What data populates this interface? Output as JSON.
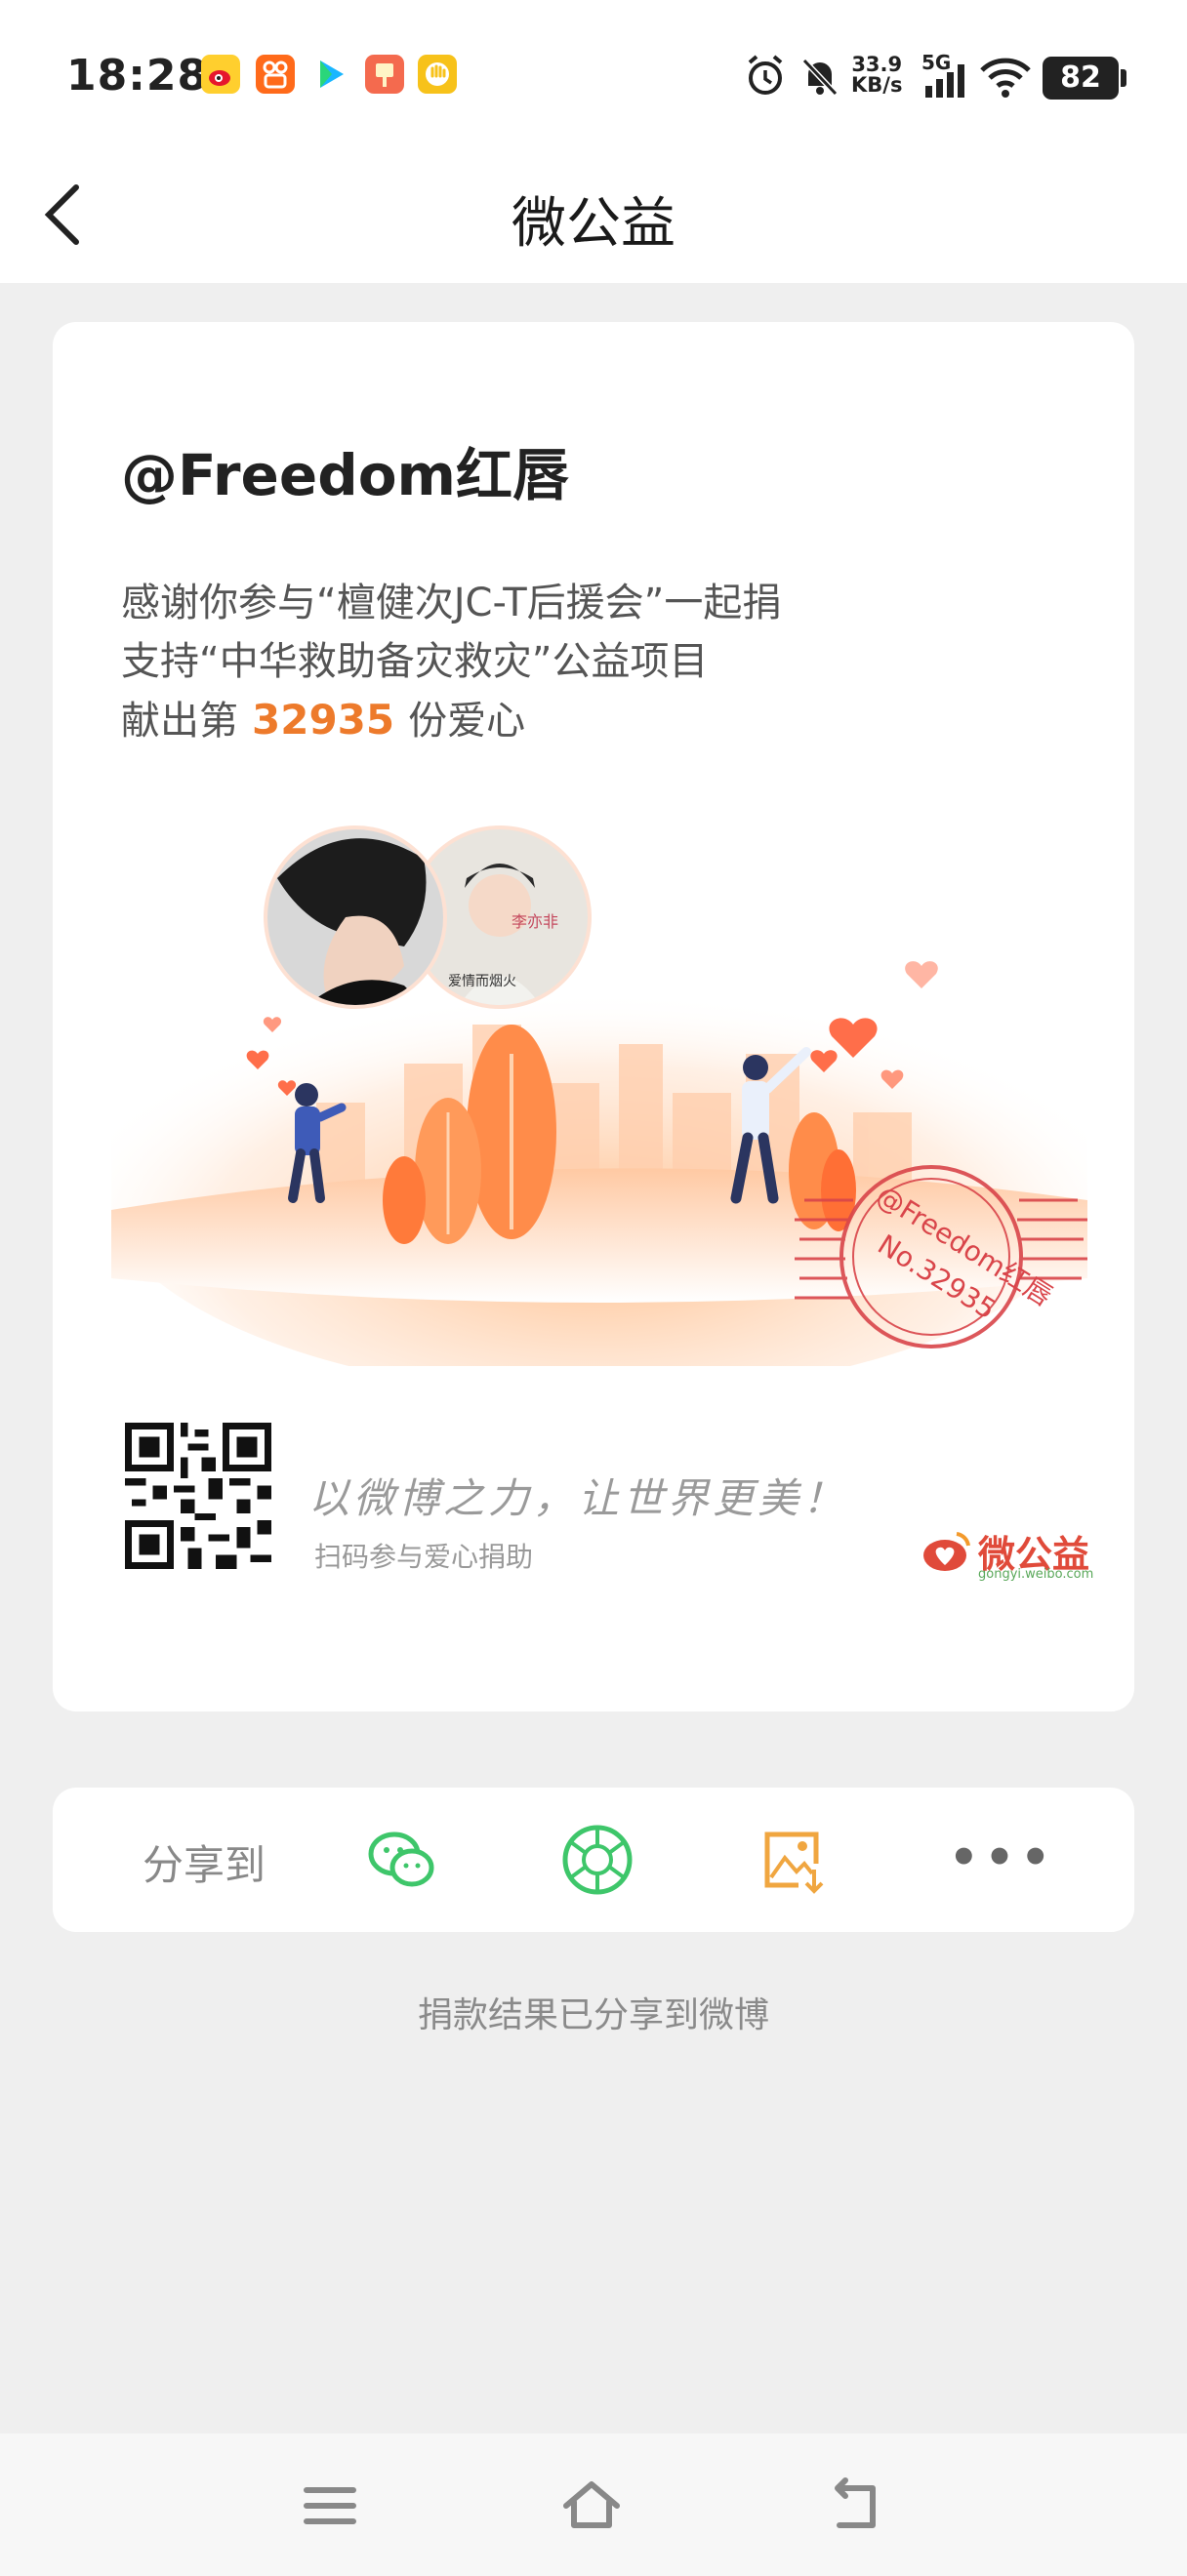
{
  "status_bar": {
    "time": "18:28",
    "net_speed_value": "33.9",
    "net_speed_unit": "KB/s",
    "network_type": "5G",
    "battery": "82",
    "notification_apps": [
      "weibo-icon",
      "kuaishou-icon",
      "video-play-icon",
      "orange-app-icon",
      "yellow-hand-app-icon"
    ],
    "indicators": [
      "alarm-icon",
      "mute-bell-icon",
      "signal-icon",
      "wifi-icon"
    ]
  },
  "nav": {
    "title": "微公益",
    "back_icon": "chevron-left-icon"
  },
  "certificate": {
    "username": "@Freedom红唇",
    "line1": "感谢你参与“檀健次JC-T后援会”一起捐",
    "line2": "支持“中华救助备灾救灾”公益项目",
    "line3_prefix": "献出第",
    "count": "32935",
    "line3_suffix": "份爱心",
    "stamp_user": "@Freedom红唇",
    "stamp_no": "No.32935",
    "slogan": "以微博之力，让世界更美！",
    "scan_hint": "扫码参与爱心捐助",
    "brand_name": "微公益",
    "brand_url": "gongyi.weibo.com"
  },
  "share": {
    "label": "分享到",
    "targets": [
      "wechat-icon",
      "moments-icon",
      "save-image-icon",
      "more-icon"
    ],
    "more_label": "•••",
    "note": "捐款结果已分享到微博"
  },
  "colors": {
    "accent_orange": "#ed7a2b",
    "wechat_green": "#3ec66a",
    "stamp_red": "#d9454a",
    "save_orange": "#f0a640"
  }
}
